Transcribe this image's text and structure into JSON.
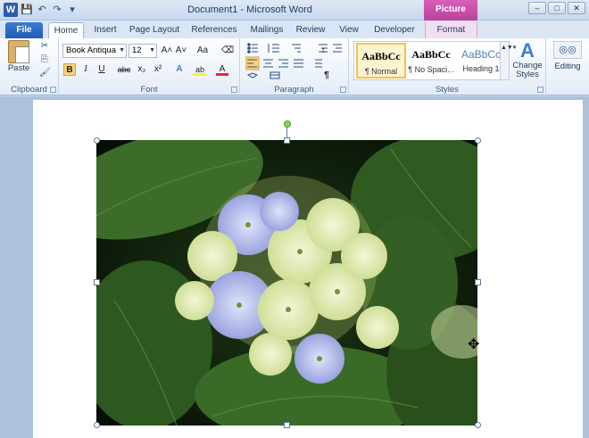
{
  "window": {
    "title": "Document1 - Microsoft Word",
    "context_tab_header": "Picture Tools",
    "app_icon_letter": "W",
    "minimize_symbol": "–",
    "maximize_symbol": "□",
    "close_symbol": "✕"
  },
  "quick_access": {
    "save": "💾",
    "undo": "↶",
    "redo": "↷",
    "customize": "▾"
  },
  "tabs": {
    "file": "File",
    "home": "Home",
    "insert": "Insert",
    "page_layout": "Page Layout",
    "references": "References",
    "mailings": "Mailings",
    "review": "Review",
    "view": "View",
    "developer": "Developer",
    "format": "Format"
  },
  "ribbon": {
    "clipboard": {
      "label": "Clipboard",
      "paste": "Paste",
      "cut_icon": "✂",
      "copy_icon": "⎘",
      "painter_icon": "🖌"
    },
    "font": {
      "label": "Font",
      "family": "Book Antiqua",
      "size": "12",
      "grow": "A˄",
      "shrink": "A˅",
      "case": "Aa",
      "clear": "⌫",
      "bold": "B",
      "italic": "I",
      "underline": "U",
      "strike": "abc",
      "subscript": "x₂",
      "superscript": "x²",
      "text_effects": "A",
      "highlight": "ab",
      "font_color": "A"
    },
    "paragraph": {
      "label": "Paragraph",
      "pilcrow": "¶",
      "sort": "↕"
    },
    "styles": {
      "label": "Styles",
      "items": [
        {
          "sample": "AaBbCc",
          "name": "¶ Normal"
        },
        {
          "sample": "AaBbCc",
          "name": "¶ No Spaci..."
        },
        {
          "sample": "AaBbCc",
          "name": "Heading 1"
        }
      ],
      "change_styles": "Change Styles",
      "gallery_arrows": "▲▼▾"
    },
    "editing": {
      "label": "Editing"
    }
  },
  "cursor_symbol": "✥",
  "colors": {
    "file_tab": "#2a66c4",
    "context_tab": "#c94aa8",
    "selected_style": "#f2c24b"
  }
}
